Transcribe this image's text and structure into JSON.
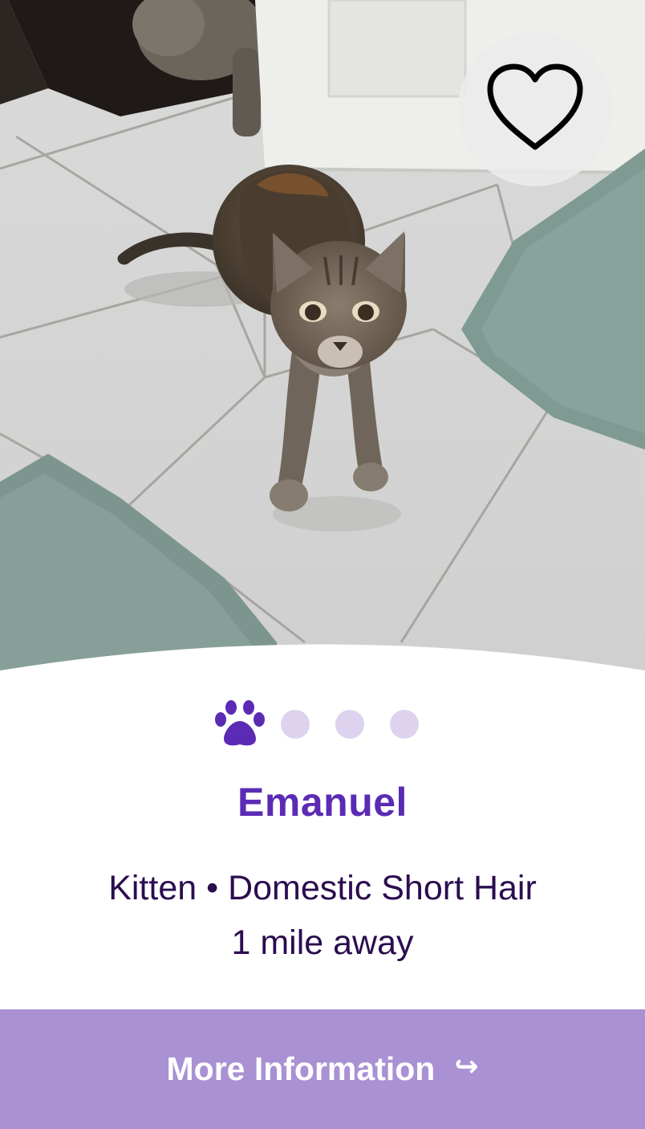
{
  "pet": {
    "name": "Emanuel",
    "age_breed": "Kitten • Domestic Short Hair",
    "distance": "1 mile away"
  },
  "photo": {
    "subject": "tabby kitten on tiled floor",
    "current_index": 1,
    "total": 4
  },
  "favorite": {
    "icon": "heart-outline-icon",
    "state": "not-favorited"
  },
  "carousel": {
    "active_icon": "paw-icon",
    "inactive_icon": "dot"
  },
  "cta": {
    "label": "More Information",
    "icon": "share-arrow-icon",
    "glyph": "↪"
  },
  "colors": {
    "accent_purple": "#5b2bb5",
    "text_dark_purple": "#2b0d4f",
    "cta_background": "#a991d4",
    "dot_inactive": "#ddd3ee"
  }
}
